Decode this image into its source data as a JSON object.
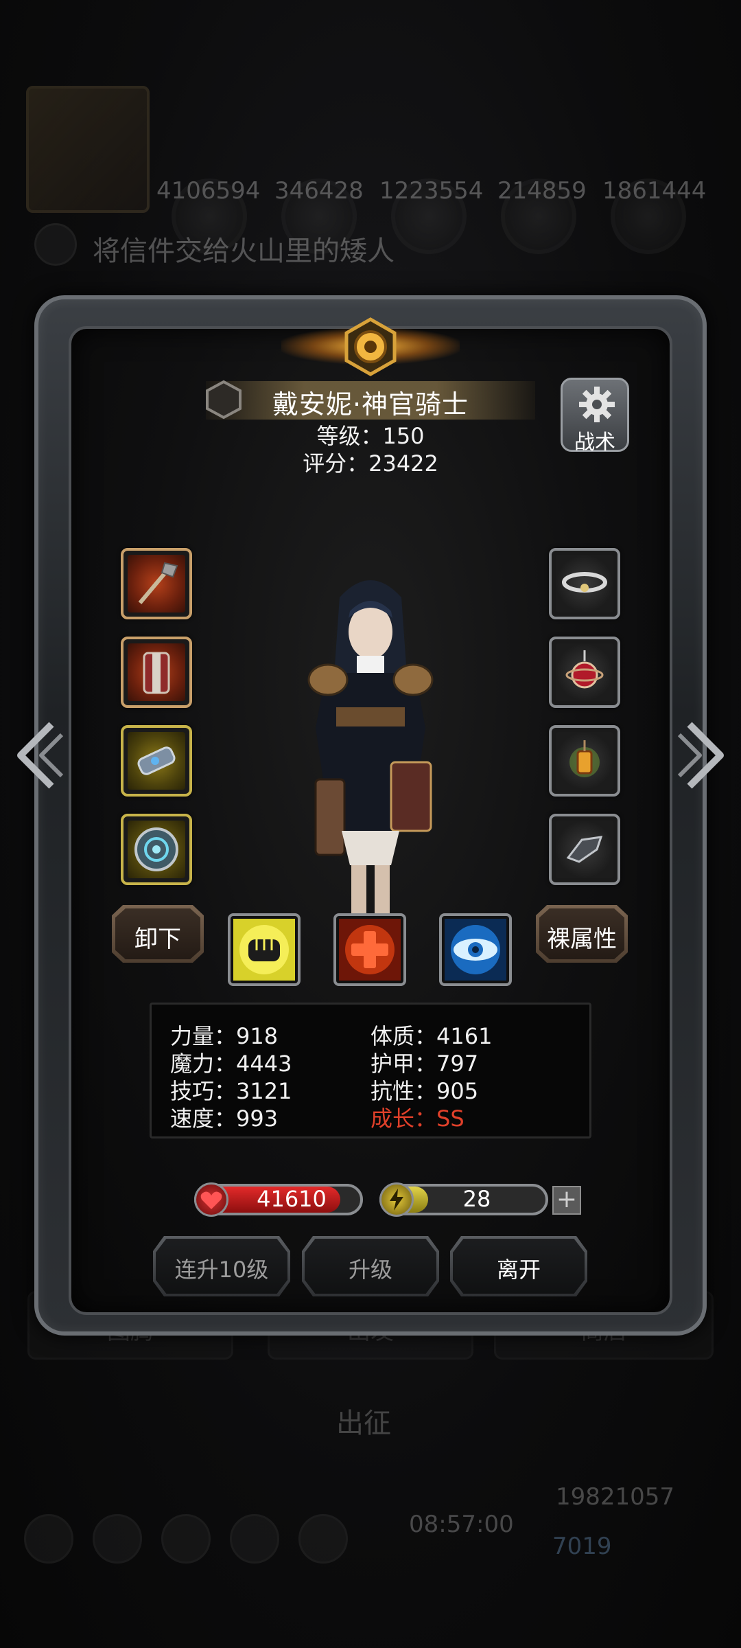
{
  "background": {
    "resources": [
      "4106594",
      "346428",
      "1223554",
      "214859",
      "1861444"
    ],
    "quest_text": "将信件交给火山里的矮人",
    "bottom_tabs": [
      "图腾",
      "出发",
      "商店"
    ],
    "expedition_label": "出征",
    "clock": "08:57:00",
    "gold": "19821057",
    "gems": "7019"
  },
  "hero": {
    "name": "戴安妮·神官骑士",
    "level": "等级：150",
    "score": "评分：23422"
  },
  "tactics": {
    "label": "战术",
    "icon": "gear-icon"
  },
  "equipment": {
    "left": [
      {
        "name": "mace-icon",
        "frame": "red"
      },
      {
        "name": "armor-icon",
        "frame": "red"
      },
      {
        "name": "gauntlet-icon",
        "frame": "yellow"
      },
      {
        "name": "shield-icon",
        "frame": "yellow"
      }
    ],
    "right": [
      {
        "name": "halo-icon",
        "frame": "grey"
      },
      {
        "name": "amulet-icon",
        "frame": "grey"
      },
      {
        "name": "lantern-icon",
        "frame": "grey"
      },
      {
        "name": "boots-icon",
        "frame": "grey"
      }
    ]
  },
  "actions": {
    "unequip": "卸下",
    "base_attributes": "裸属性",
    "skills": [
      "fist-skill-icon",
      "heal-cross-skill-icon",
      "eye-skill-icon"
    ]
  },
  "stats": {
    "strength": "力量：918",
    "magic": "魔力：4443",
    "skill": "技巧：3121",
    "speed": "速度：993",
    "constitution": "体质：4161",
    "armor": "护甲：797",
    "resistance": "抗性：905",
    "growth": "成长：SS"
  },
  "bars": {
    "hp": "41610",
    "hp_fill": 0.88,
    "energy": "28",
    "energy_fill": 0.28,
    "plus": "+"
  },
  "buttons": {
    "level_up_10": "连升10级",
    "level_up": "升级",
    "leave": "离开"
  },
  "colors": {
    "growth": "#e0402a",
    "hp": "#e32a2a",
    "energy": "#e2d44a"
  }
}
